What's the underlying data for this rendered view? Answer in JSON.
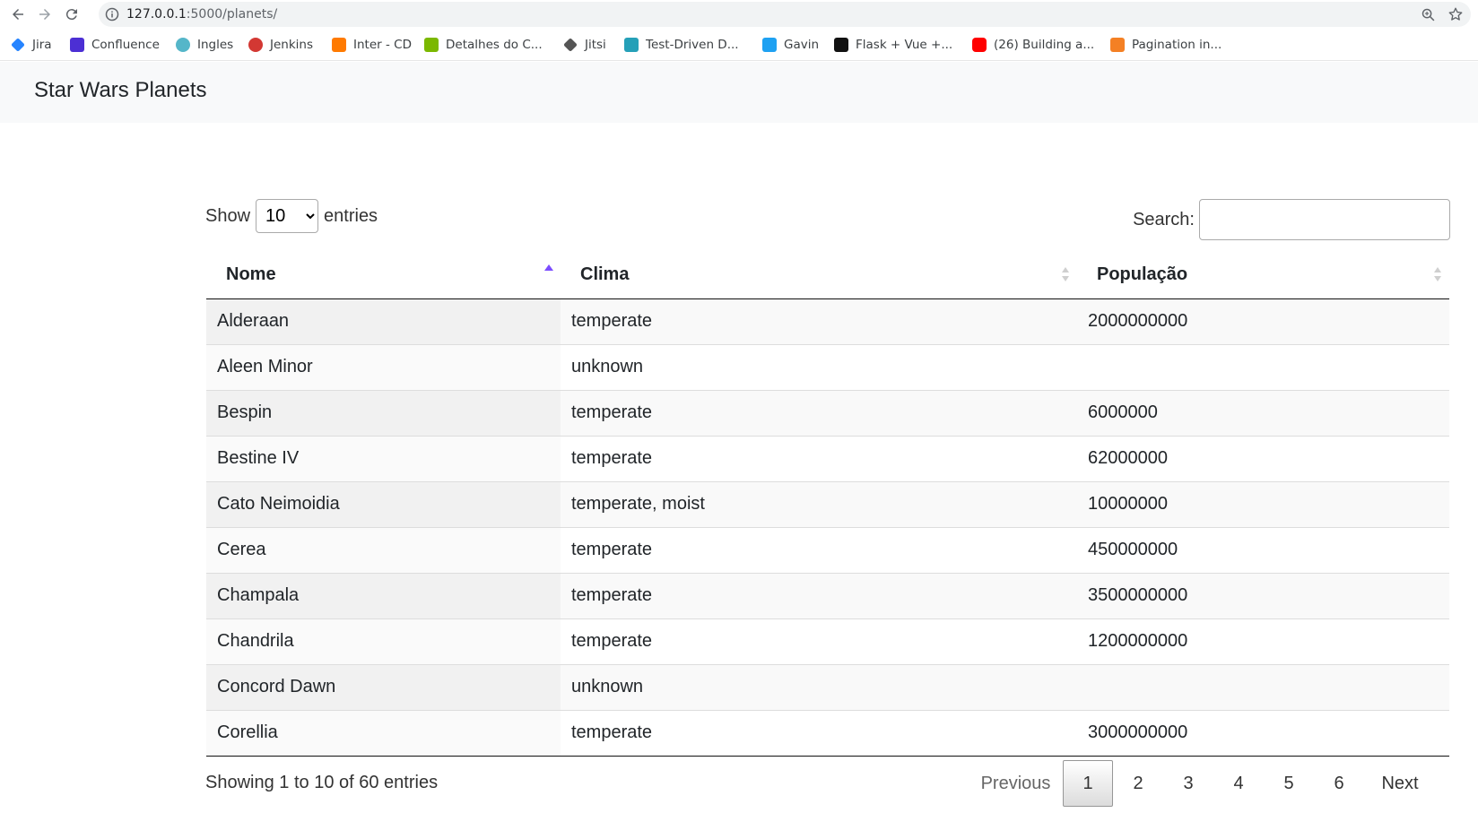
{
  "browser": {
    "url_host": "127.0.0.1",
    "url_path": ":5000/planets/",
    "bookmarks": [
      {
        "label": "Jira",
        "color": "#2684ff"
      },
      {
        "label": "Confluence",
        "color": "#4c2fd4"
      },
      {
        "label": "Ingles",
        "color": "#55b6c9"
      },
      {
        "label": "Jenkins",
        "color": "#d33833"
      },
      {
        "label": "Inter - CD",
        "color": "#ff7a00"
      },
      {
        "label": "Detalhes do C...",
        "color": "#7bb800"
      },
      {
        "label": "Jitsi",
        "color": "#555555"
      },
      {
        "label": "Test-Driven D...",
        "color": "#25a0b8"
      },
      {
        "label": "Gavin",
        "color": "#1ea1f2"
      },
      {
        "label": "Flask + Vue +...",
        "color": "#111111"
      },
      {
        "label": "(26) Building a...",
        "color": "#ff0000"
      },
      {
        "label": "Pagination in...",
        "color": "#f48024"
      }
    ]
  },
  "navbar": {
    "brand": "Star Wars Planets"
  },
  "controls": {
    "show_label": "Show",
    "length_value": "10",
    "entries_label": "entries",
    "search_label": "Search:",
    "search_value": ""
  },
  "table": {
    "headers": [
      "Nome",
      "Clima",
      "População"
    ],
    "sorted_column": "Nome",
    "sort_color": "#7c4dff",
    "rows": [
      [
        "Alderaan",
        "temperate",
        "2000000000"
      ],
      [
        "Aleen Minor",
        "unknown",
        ""
      ],
      [
        "Bespin",
        "temperate",
        "6000000"
      ],
      [
        "Bestine IV",
        "temperate",
        "62000000"
      ],
      [
        "Cato Neimoidia",
        "temperate, moist",
        "10000000"
      ],
      [
        "Cerea",
        "temperate",
        "450000000"
      ],
      [
        "Champala",
        "temperate",
        "3500000000"
      ],
      [
        "Chandrila",
        "temperate",
        "1200000000"
      ],
      [
        "Concord Dawn",
        "unknown",
        ""
      ],
      [
        "Corellia",
        "temperate",
        "3000000000"
      ]
    ]
  },
  "footer": {
    "info": "Showing 1 to 10 of 60 entries",
    "previous": "Previous",
    "pages": [
      "1",
      "2",
      "3",
      "4",
      "5",
      "6"
    ],
    "current_page": "1",
    "next": "Next"
  }
}
